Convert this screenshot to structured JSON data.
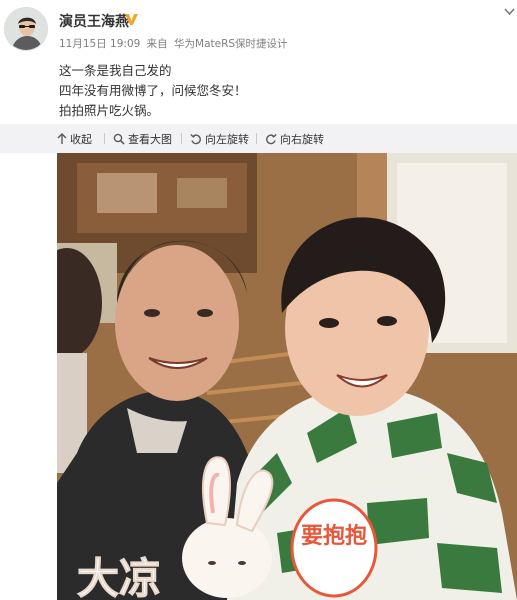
{
  "author": {
    "name": "演员王海燕",
    "verified_badge": "V",
    "avatar_icon": "user-avatar-icon"
  },
  "meta": {
    "date": "11月15日 19:09",
    "source_prefix": "来自",
    "source_device": "华为MateRS保时捷设计"
  },
  "post": {
    "lines": [
      "这一条是我自己发的",
      "四年没有用微博了，问候您冬安！",
      "拍拍照片吃火锅。"
    ]
  },
  "toolbar": {
    "collapse": {
      "label": "收起",
      "icon": "collapse-up-arrow-icon"
    },
    "view_large": {
      "label": "查看大图",
      "icon": "magnify-icon"
    },
    "rotate_left": {
      "label": "向左旋转",
      "icon": "rotate-left-icon"
    },
    "rotate_right": {
      "label": "向右旋转",
      "icon": "rotate-right-icon"
    }
  },
  "photo": {
    "sticker_text_left": "大凉",
    "sticker_text_right": "要抱抱",
    "sticker_icon": "bunny-sticker-icon"
  },
  "colors": {
    "verified": "#f5a623",
    "text": "#333333",
    "meta_text": "#808080",
    "toolbar_bg": "#f2f2f5",
    "sticker_orange": "#e9573a"
  }
}
